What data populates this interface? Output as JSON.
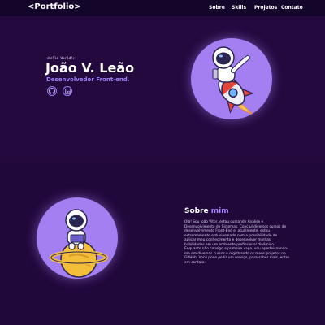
{
  "nav": {
    "logo": "<Portfolio>",
    "links": [
      "Sobre",
      "Skills",
      "Projetos",
      "Contato"
    ]
  },
  "hero": {
    "greeting": "<Hello World!>",
    "name": "João V. Leão",
    "role": "Desenvolvedor Front-end.",
    "social": [
      "github-icon",
      "linkedin-icon"
    ]
  },
  "about": {
    "title_plain": "Sobre ",
    "title_highlight": "mim",
    "text": "Olá! Sou João Vitor, estou cursando Análise e Desenvolvimento de Sistemas. Concluí diversos cursos de desenvolvimento Front-End e, atualmente, estou extremamente entusiasmado com a possibilidade de aplicar meu conhecimento e desenvolver minhas habilidades em um ambiente profissional dinâmico. Enquanto não consigo a primeira vaga, vou aperfeiçoando-me em diversos cursos e registrando os meus projetos no GitHub. Você pode pedir um serviço, para saber mais, entre em contato."
  },
  "colors": {
    "background": "#24093f",
    "nav": "#14052a",
    "accent": "#9b7ff7",
    "circle": "#a47ff2"
  }
}
